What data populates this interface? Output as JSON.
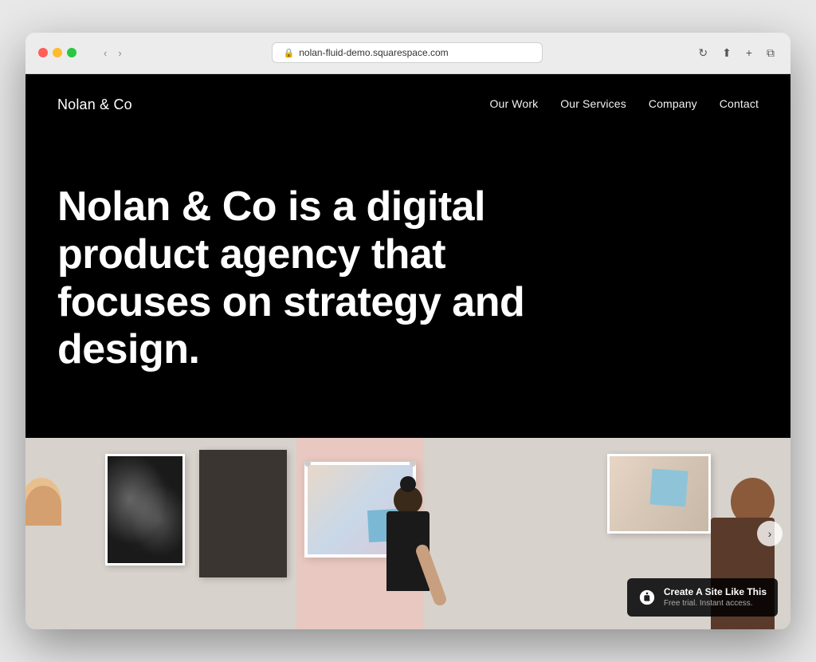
{
  "browser": {
    "url": "nolan-fluid-demo.squarespace.com",
    "controls": {
      "back": "‹",
      "forward": "›",
      "reload": "↻",
      "share": "⬆",
      "new_tab": "+",
      "duplicate": "⧉"
    },
    "window_icon": "⬜"
  },
  "nav": {
    "logo": "Nolan & Co",
    "links": [
      {
        "label": "Our Work"
      },
      {
        "label": "Our Services"
      },
      {
        "label": "Company"
      },
      {
        "label": "Contact"
      }
    ]
  },
  "hero": {
    "headline": "Nolan & Co is a digital product agency that focuses on strategy and design."
  },
  "squarespace_badge": {
    "title": "Create A Site Like This",
    "subtitle": "Free trial. Instant access."
  },
  "nav_arrow": "›"
}
